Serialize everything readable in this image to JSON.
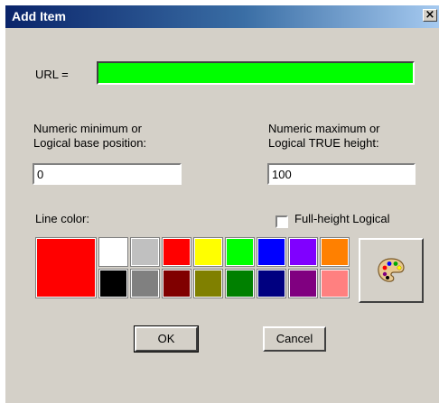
{
  "dialog": {
    "title": "Add Item",
    "close_label": "×"
  },
  "url": {
    "label": "URL =",
    "value": "",
    "fill_color": "#00ff00"
  },
  "min": {
    "label_line1": "Numeric minimum or",
    "label_line2": "Logical base position:",
    "value": "0"
  },
  "max": {
    "label_line1": "Numeric maximum or",
    "label_line2": "Logical TRUE height:",
    "value": "100"
  },
  "line_color": {
    "label": "Line color:",
    "selected": "#ff0000",
    "top_row": [
      "#ffffff",
      "#c0c0c0",
      "#ff0000",
      "#ffff00",
      "#00ff00",
      "#0000ff",
      "#8000ff",
      "#ff8000"
    ],
    "bottom_row": [
      "#000000",
      "#808080",
      "#800000",
      "#808000",
      "#008000",
      "#000080",
      "#800080",
      "#ff8080"
    ],
    "palette_icon": "paint-palette-icon"
  },
  "full_height": {
    "label": "Full-height Logical",
    "checked": false
  },
  "buttons": {
    "ok": "OK",
    "cancel": "Cancel"
  }
}
